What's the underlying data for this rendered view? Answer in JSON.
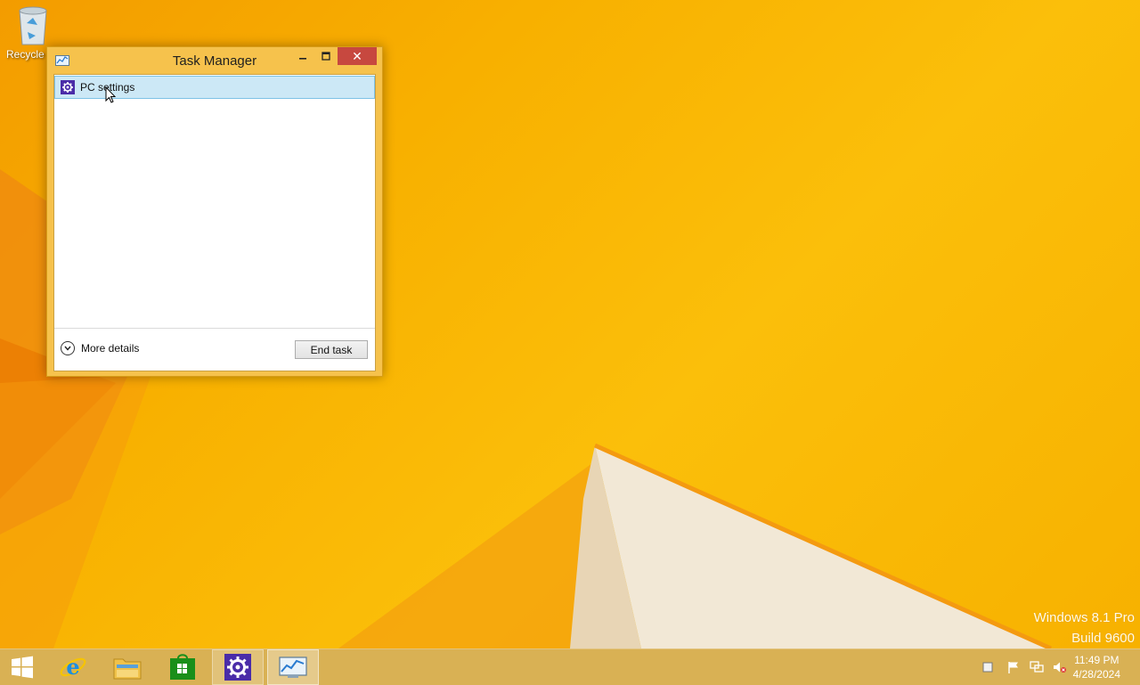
{
  "desktop": {
    "recycle_bin_label": "Recycle Bin",
    "watermark_line1": "Windows 8.1 Pro",
    "watermark_line2": "Build 9600"
  },
  "window": {
    "title": "Task Manager",
    "minimize_icon": "minimize-icon",
    "maximize_icon": "maximize-icon",
    "close_icon": "close-icon",
    "tasks": [
      {
        "name": "PC settings",
        "icon": "gear-icon",
        "selected": true
      }
    ],
    "more_details_label": "More details",
    "end_task_label": "End task"
  },
  "taskbar": {
    "items": [
      {
        "name": "Start",
        "icon": "windows-logo-icon"
      },
      {
        "name": "Internet Explorer",
        "icon": "ie-icon"
      },
      {
        "name": "File Explorer",
        "icon": "folder-icon"
      },
      {
        "name": "Store",
        "icon": "store-icon"
      },
      {
        "name": "PC settings",
        "icon": "gear-icon",
        "active": true
      },
      {
        "name": "Task Manager",
        "icon": "task-manager-icon",
        "active": true
      }
    ],
    "tray_icons": [
      "action-center-icon",
      "flag-icon",
      "network-icon",
      "volume-muted-icon"
    ],
    "time": "11:49 PM",
    "date": "4/28/2024"
  },
  "colors": {
    "wallpaper": "#f8b400",
    "window_frame": "#f6c24c",
    "close_button": "#c7483f",
    "selection": "#cce8f6",
    "settings_tile": "#4a2ca8"
  }
}
